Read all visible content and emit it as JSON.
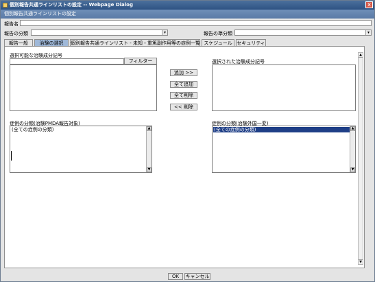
{
  "window": {
    "title": "個別報告共通ラインリストの設定 -- Webpage Dialog",
    "subtitle": "個別報告共通ラインリストの設定"
  },
  "form": {
    "report_name_label": "報告名",
    "report_category_label": "報告の分類",
    "quasi_category_label": "報告の準分類"
  },
  "tabs": [
    "報告一般",
    "治験の選択",
    "個別報告共通ラインリスト - 未知・重篤副作用等の症例一覧",
    "スケジュール",
    "セキュリティ"
  ],
  "panel": {
    "available_label": "選択可能な治験成分記号",
    "filter_button": "フィルター",
    "selected_label": "選択された治験成分記号",
    "add_button": "追加 >>",
    "add_all_button": "全て追加",
    "remove_all_button": "全て削除",
    "remove_button": "<< 削除",
    "case_category_pmda_label": "症例の分類(治験PMDA報告対象)",
    "case_category_pmda_item": "(全ての症例の分類)",
    "case_category_foreign_label": "症例の分類(治験外国一変)",
    "case_category_foreign_item": "(全ての症例の分類)"
  },
  "footer": {
    "ok_button": "OK",
    "cancel_button": "キャンセル"
  }
}
